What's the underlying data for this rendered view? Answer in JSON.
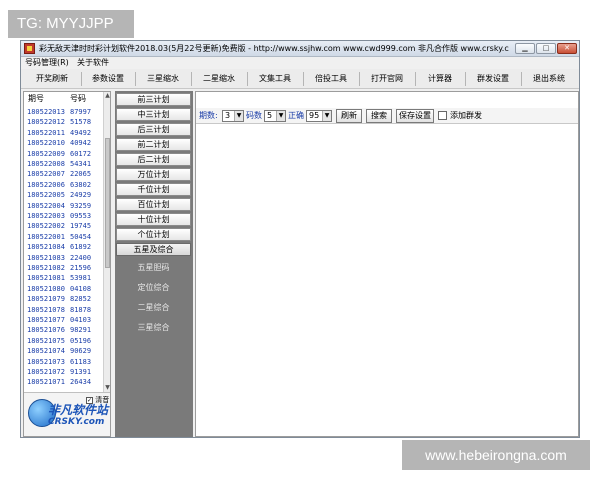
{
  "watermark": {
    "top": "TG: MYYJJPP",
    "bottom": "www.hebeirongna.com"
  },
  "window": {
    "title": "彩无敌天津时时彩计划软件2018.03(5月22号更新)免费版 - http://www.ssjhw.com www.cwd999.com 非凡合作版 www.crsky.com",
    "min_symbol": "▁",
    "max_symbol": "□",
    "close_symbol": "✕"
  },
  "menu": {
    "items": [
      "号码管理(R)",
      "关于软件"
    ]
  },
  "toolbar": {
    "buttons": [
      "开奖刷新",
      "参数设置",
      "三星缩水",
      "二星缩水",
      "文集工具",
      "倍投工具",
      "打开官网",
      "计算器",
      "群发设置",
      "退出系统"
    ]
  },
  "left": {
    "headers": [
      "期号",
      "号码"
    ],
    "rows": [
      [
        "180522013",
        "87997"
      ],
      [
        "180522012",
        "51578"
      ],
      [
        "180522011",
        "49492"
      ],
      [
        "180522010",
        "40942"
      ],
      [
        "180522009",
        "60172"
      ],
      [
        "180522008",
        "54341"
      ],
      [
        "180522007",
        "22065"
      ],
      [
        "180522006",
        "63802"
      ],
      [
        "180522005",
        "24929"
      ],
      [
        "180522004",
        "93259"
      ],
      [
        "180522003",
        "09553"
      ],
      [
        "180522002",
        "19745"
      ],
      [
        "180522001",
        "50454"
      ],
      [
        "180521084",
        "61892"
      ],
      [
        "180521083",
        "22400"
      ],
      [
        "180521082",
        "21596"
      ],
      [
        "180521081",
        "53981"
      ],
      [
        "180521080",
        "04108"
      ],
      [
        "180521079",
        "82852"
      ],
      [
        "180521078",
        "81878"
      ],
      [
        "180521077",
        "04103"
      ],
      [
        "180521076",
        "98291"
      ],
      [
        "180521075",
        "05196"
      ],
      [
        "180521074",
        "90629"
      ],
      [
        "180521073",
        "61183"
      ],
      [
        "180521072",
        "91391"
      ],
      [
        "180521071",
        "26434"
      ]
    ],
    "scroll_up": "▲",
    "scroll_down": "▼",
    "logo_text": "非凡软件站",
    "logo_sub": "CRSKY.com",
    "logo_checkbox": "清音",
    "logo_check_mark": "✓"
  },
  "middle": {
    "plans": [
      "前三计划",
      "中三计划",
      "后三计划",
      "前二计划",
      "后二计划",
      "万位计划",
      "千位计划",
      "百位计划",
      "十位计划",
      "个位计划",
      "五星及综合"
    ],
    "links": [
      "五星胆码",
      "定位综合",
      "二星综合",
      "三星综合"
    ]
  },
  "right": {
    "period_label": "期数:",
    "period_value": "3",
    "code_label": "码数",
    "code_value": "5",
    "accuracy_label": "正确",
    "accuracy_value": "95",
    "refresh_btn": "刷新",
    "search_btn": "搜索",
    "save_btn": "保存设置",
    "mass_label": "添加群发",
    "dropdown_arrow": "▼"
  }
}
